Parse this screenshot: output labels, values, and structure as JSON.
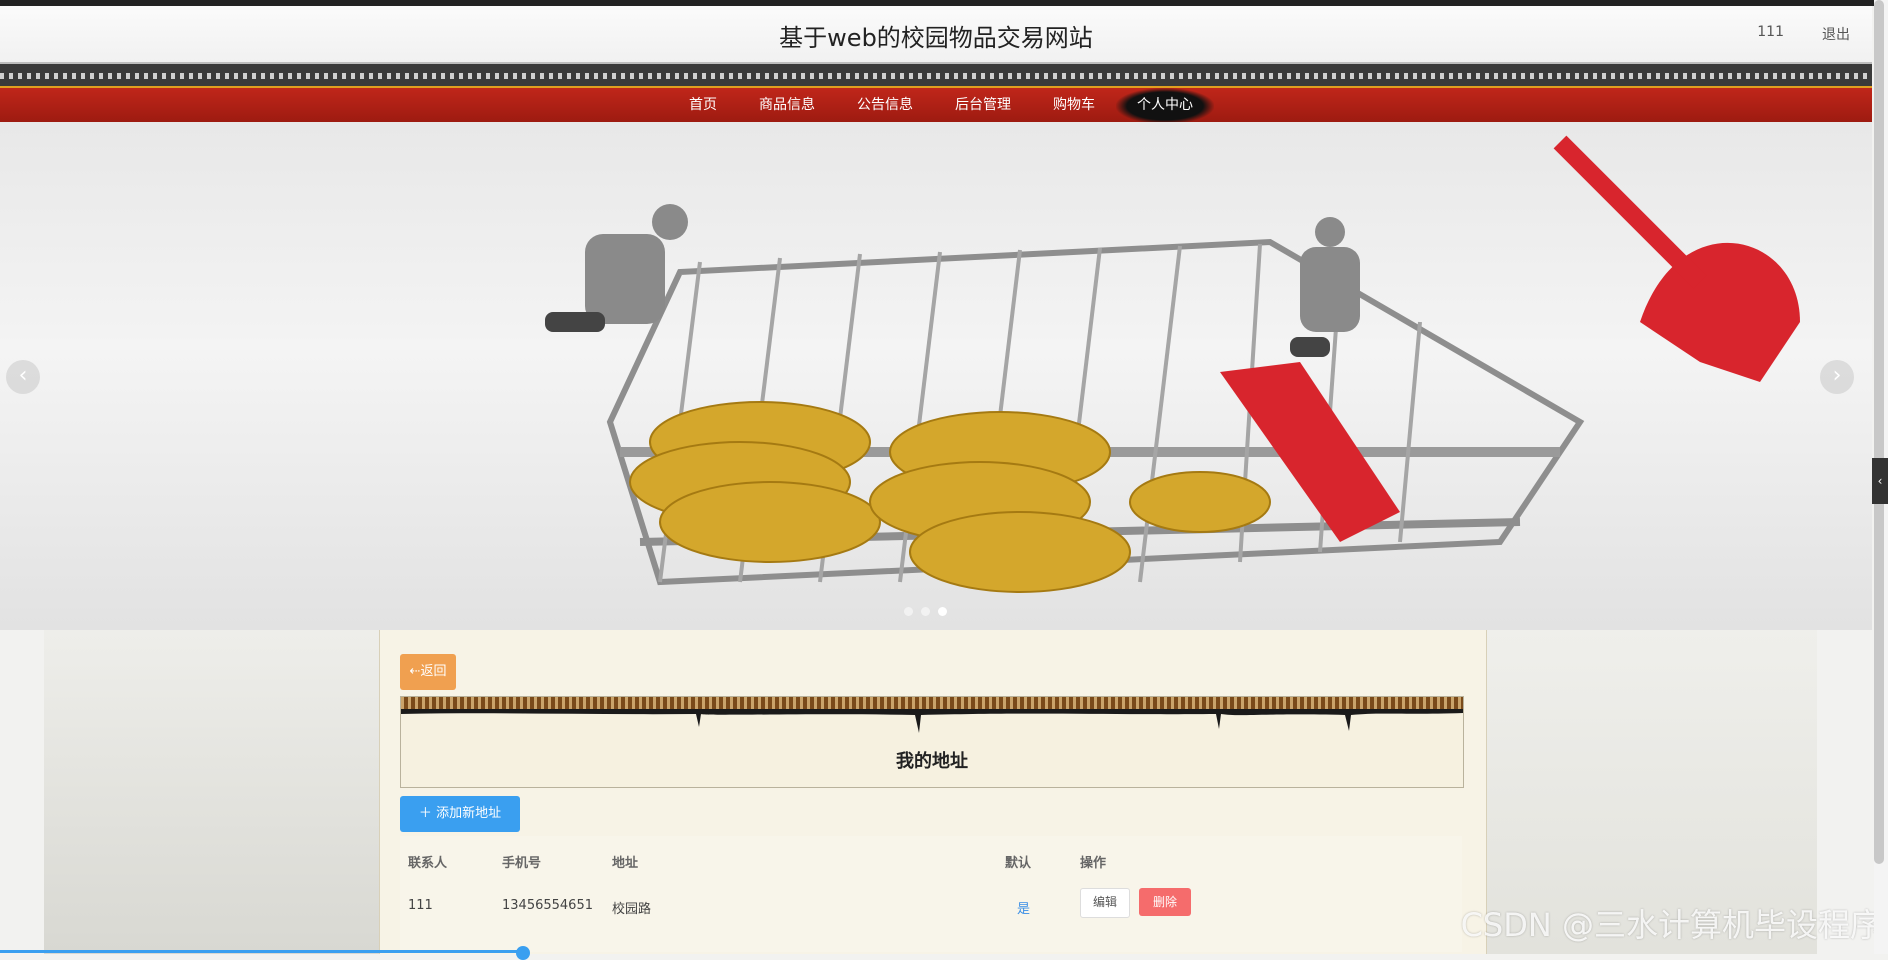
{
  "header": {
    "title": "基于web的校园物品交易网站",
    "user": "111",
    "logout": "退出"
  },
  "nav": {
    "items": [
      {
        "label": "首页"
      },
      {
        "label": "商品信息"
      },
      {
        "label": "公告信息"
      },
      {
        "label": "后台管理"
      },
      {
        "label": "购物车"
      },
      {
        "label": "个人中心"
      }
    ],
    "active": "个人中心"
  },
  "carousel": {
    "prev": "‹",
    "next": "›",
    "slide_count": 3,
    "active_slide": 3
  },
  "page": {
    "back": "返回",
    "heading": "我的地址",
    "add_button": "添加新地址"
  },
  "table": {
    "columns": [
      "联系人",
      "手机号",
      "地址",
      "默认",
      "操作"
    ],
    "rows": [
      {
        "contact": "111",
        "phone": "13456554651",
        "address": "校园路",
        "default": "是",
        "edit": "编辑",
        "delete": "删除"
      }
    ]
  },
  "watermark": "CSDN @三水计算机毕设程序",
  "colors": {
    "nav_bg": "#b12015",
    "primary": "#3a9ff0",
    "danger": "#f56c6c",
    "back": "#f0a050"
  }
}
